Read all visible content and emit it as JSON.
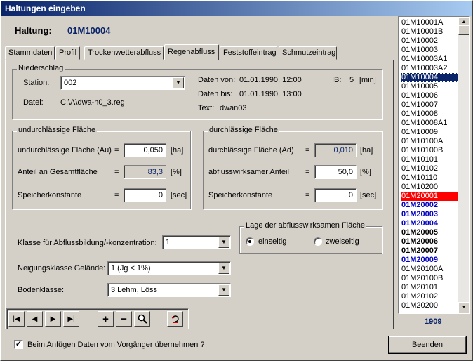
{
  "window": {
    "title": "Haltungen eingeben"
  },
  "haltung": {
    "label": "Haltung:",
    "value": "01M10004"
  },
  "tabs": [
    "Stammdaten",
    "Profil",
    "Trockenwetterabfluss",
    "Regenabfluss",
    "Feststoffeintrag",
    "Schmutzeintrag"
  ],
  "niederschlag": {
    "title": "Niederschlag",
    "station_label": "Station:",
    "station_value": "002",
    "datei_label": "Datei:",
    "datei_value": "C:\\A\\dwa-n0_3.reg",
    "daten_von_label": "Daten von:",
    "daten_von_value": "01.01.1990,  12:00",
    "daten_bis_label": "Daten bis:",
    "daten_bis_value": "01.01.1990,  13:00",
    "text_label": "Text:",
    "text_value": "dwan03",
    "ib_label": "IB:",
    "ib_value": "5",
    "ib_unit": "[min]"
  },
  "undurch": {
    "title": "undurchlässige Fläche",
    "rows": [
      {
        "label": "undurchlässige Fläche (Au)",
        "eq": "=",
        "value": "0,050",
        "unit": "[ha]"
      },
      {
        "label": "Anteil an Gesamtfläche",
        "eq": "=",
        "value": "83,3",
        "unit": "[%]"
      },
      {
        "label": "Speicherkonstante",
        "eq": "=",
        "value": "0",
        "unit": "[sec]"
      }
    ]
  },
  "durch": {
    "title": "durchlässige Fläche",
    "rows": [
      {
        "label": "durchlässige Fläche (Ad)",
        "eq": "=",
        "value": "0,010",
        "unit": "[ha]"
      },
      {
        "label": "abflusswirksamer Anteil",
        "eq": "=",
        "value": "50,0",
        "unit": "[%]"
      },
      {
        "label": "Speicherkonstante",
        "eq": "=",
        "value": "0",
        "unit": "[sec]"
      }
    ]
  },
  "klasse": {
    "label": "Klasse für Abflussbildung/-konzentration:",
    "value": "1"
  },
  "neigung": {
    "label": "Neigungsklasse Gelände:",
    "value": "1 (Jg < 1%)"
  },
  "boden": {
    "label": "Bodenklasse:",
    "value": "3 Lehm, Löss"
  },
  "lage": {
    "title": "Lage der abflusswirksamen Fläche",
    "opt1": "einseitig",
    "opt2": "zweiseitig"
  },
  "list": {
    "items": [
      "01M10001A",
      "01M10001B",
      "01M10002",
      "01M10003",
      "01M10003A1",
      "01M10003A2",
      "01M10004",
      "01M10005",
      "01M10006",
      "01M10007",
      "01M10008",
      "01M10008A1",
      "01M10009",
      "01M10100A",
      "01M10100B",
      "01M10101",
      "01M10102",
      "01M10110",
      "01M10200",
      "01M20001",
      "01M20002",
      "01M20003",
      "01M20004",
      "01M20005",
      "01M20006",
      "01M20007",
      "01M20009",
      "01M20100A",
      "01M20100B",
      "01M20101",
      "01M20102",
      "01M20200"
    ],
    "count": "1909"
  },
  "footer": {
    "checkbox_label": "Beim Anfügen Daten vom Vorgänger übernehmen ?",
    "beenden": "Beenden"
  },
  "colors": {
    "accent": "#0a246a",
    "red_item": "#ff0000",
    "blue_item": "#0000c0"
  }
}
